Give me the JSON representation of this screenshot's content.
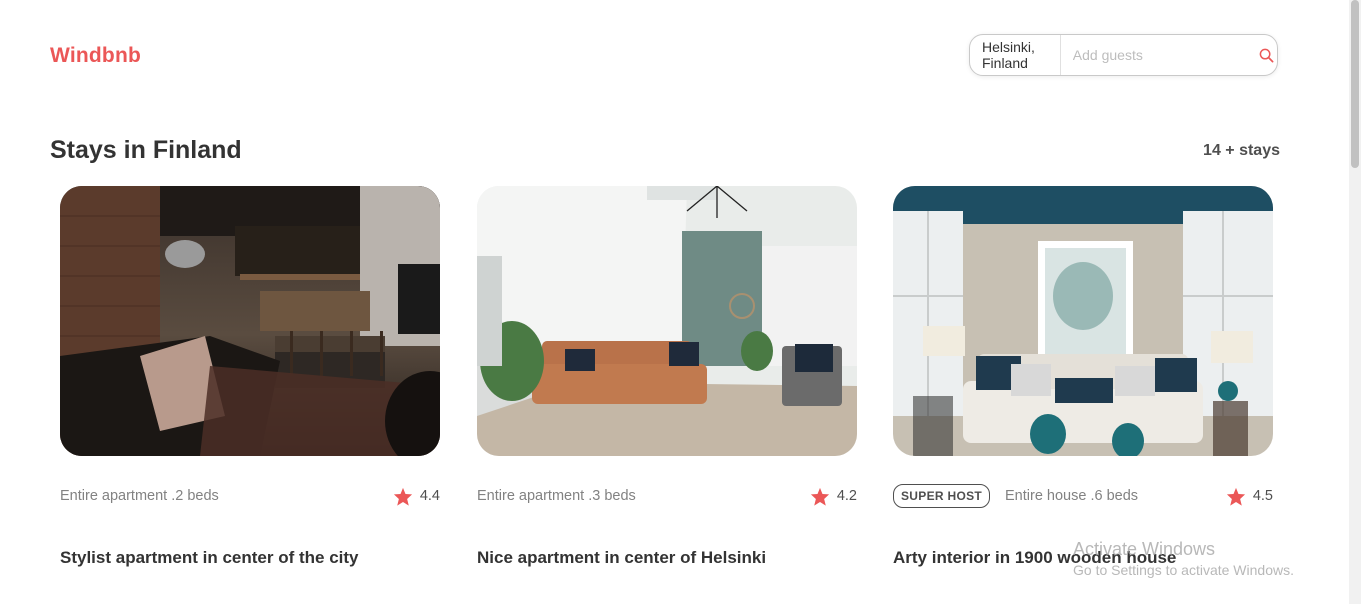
{
  "header": {
    "logo": "Windbnb",
    "search": {
      "location": "Helsinki, Finland",
      "guests_placeholder": "Add guests",
      "search_icon": "search-icon"
    }
  },
  "main": {
    "title": "Stays in Finland",
    "count": "14 + stays"
  },
  "stays": [
    {
      "type": "Entire apartment .2 beds",
      "rating": "4.4",
      "title": "Stylist apartment in center of the city",
      "super_host": false
    },
    {
      "type": "Entire apartment .3 beds",
      "rating": "4.2",
      "title": "Nice apartment in center of Helsinki",
      "super_host": false
    },
    {
      "type": "Entire house .6 beds",
      "rating": "4.5",
      "title": "Arty interior in 1900 wooden house",
      "super_host": true,
      "badge": "SUPER HOST"
    }
  ],
  "watermark": {
    "line1": "Activate Windows",
    "line2": "Go to Settings to activate Windows."
  },
  "colors": {
    "accent": "#eb5757",
    "text": "#333333",
    "muted": "#828282"
  }
}
